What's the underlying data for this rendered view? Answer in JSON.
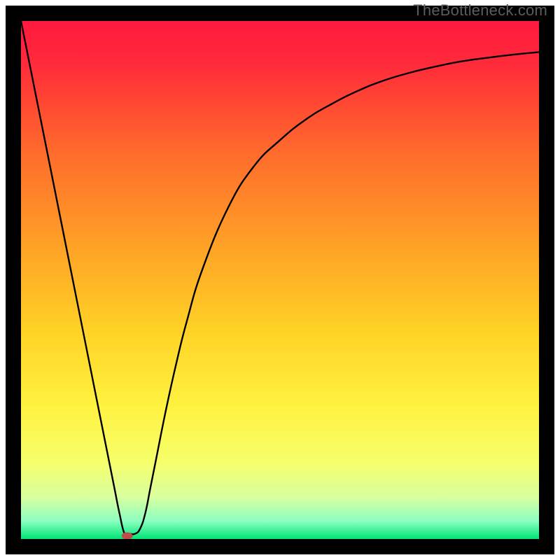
{
  "watermark": {
    "text": "TheBottleneck.com"
  },
  "chart_data": {
    "type": "line",
    "title": "",
    "xlabel": "",
    "ylabel": "",
    "xlim": [
      0,
      100
    ],
    "ylim": [
      0,
      100
    ],
    "grid": false,
    "legend": false,
    "series": [
      {
        "name": "bottleneck-curve",
        "x": [
          0,
          2,
          4,
          6,
          8,
          10,
          12,
          14,
          16,
          18,
          19,
          20,
          21,
          22,
          23,
          24,
          25,
          26,
          28,
          30,
          32,
          35,
          40,
          45,
          50,
          55,
          60,
          65,
          70,
          75,
          80,
          85,
          90,
          95,
          100
        ],
        "y": [
          100,
          90,
          80,
          70,
          60,
          50,
          40,
          30,
          20,
          10,
          5,
          1,
          1,
          1,
          2,
          5,
          10,
          15,
          25,
          34,
          42,
          52,
          64,
          72,
          77,
          81,
          84,
          86.5,
          88.5,
          90,
          91.2,
          92.2,
          92.9,
          93.5,
          94
        ],
        "color": "#000000"
      }
    ],
    "marker": {
      "name": "optimal-point",
      "x": 20.5,
      "y": 0.6,
      "color": "#c14b4b",
      "rx": 8,
      "ry": 5
    },
    "gradient_stops": [
      {
        "offset": 0.0,
        "color": "#ff1a40"
      },
      {
        "offset": 0.08,
        "color": "#ff2a3a"
      },
      {
        "offset": 0.25,
        "color": "#ff6a2c"
      },
      {
        "offset": 0.45,
        "color": "#ffa626"
      },
      {
        "offset": 0.6,
        "color": "#ffd326"
      },
      {
        "offset": 0.74,
        "color": "#fff140"
      },
      {
        "offset": 0.85,
        "color": "#f6ff6a"
      },
      {
        "offset": 0.92,
        "color": "#d8ffa0"
      },
      {
        "offset": 0.965,
        "color": "#8cffc0"
      },
      {
        "offset": 1.0,
        "color": "#00e676"
      }
    ],
    "frame": {
      "outer_margin": 8,
      "border_thickness": 22,
      "border_color": "#000000"
    }
  }
}
